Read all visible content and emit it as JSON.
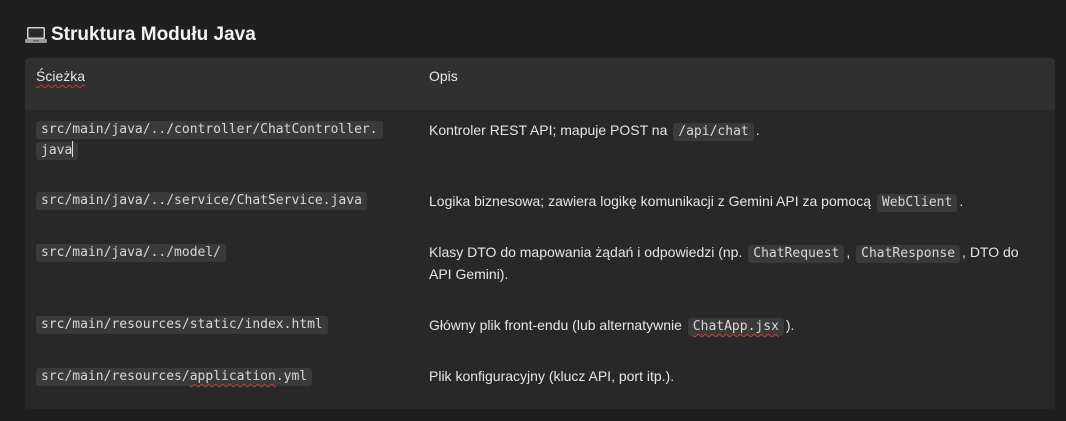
{
  "heading": {
    "icon": "laptop-icon",
    "title": "Struktura Modułu Java"
  },
  "table": {
    "columns": [
      "Ścieżka",
      "Opis"
    ],
    "rows": [
      {
        "path_line1": "src/main/java/../controller/ChatController.",
        "path_line2": "java",
        "desc_before": "Kontroler REST API; mapuje POST na",
        "desc_code": "/api/chat",
        "desc_after": "."
      },
      {
        "path": "src/main/java/../service/ChatService.java",
        "desc_before": "Logika biznesowa; zawiera logikę komunikacji z Gemini API za pomocą",
        "desc_code": "WebClient",
        "desc_after": "."
      },
      {
        "path": "src/main/java/../model/",
        "desc_before": "Klasy DTO do mapowania żądań i odpowiedzi (np.",
        "desc_code1": "ChatRequest",
        "desc_mid": ",",
        "desc_code2": "ChatResponse",
        "desc_after": ", DTO do API Gemini)."
      },
      {
        "path": "src/main/resources/static/index.html",
        "desc_before": "Główny plik front-endu (lub alternatywnie",
        "desc_code": "ChatApp.jsx",
        "desc_after": ")."
      },
      {
        "path_before": "src/main/resources/",
        "path_spell": "application",
        "path_after": ".yml",
        "desc": "Plik konfiguracyjny (klucz API, port itp.)."
      }
    ]
  }
}
